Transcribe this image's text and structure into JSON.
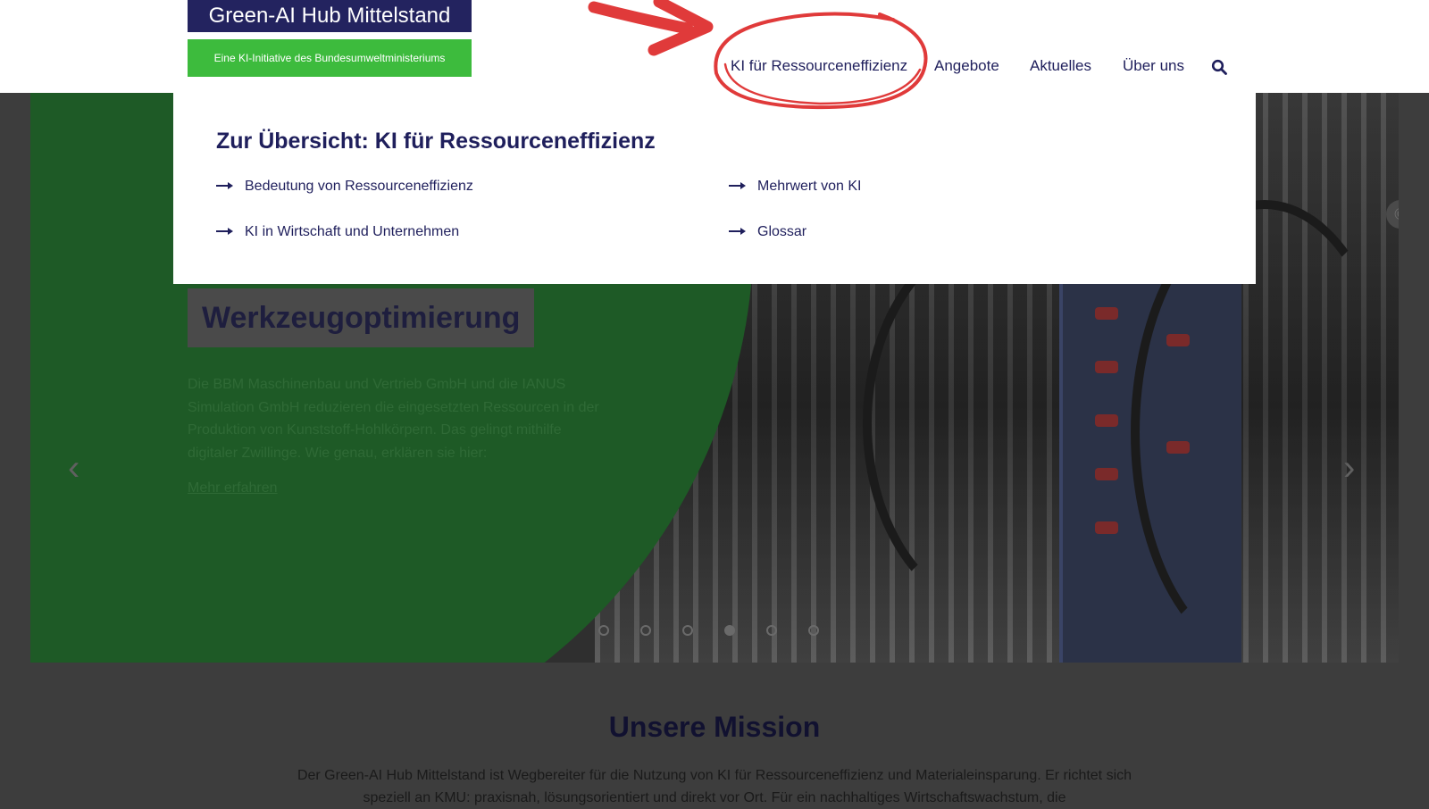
{
  "header": {
    "logo_title": "Green-AI Hub Mittelstand",
    "logo_subtitle": "Eine KI-Initiative des Bundesumweltministeriums",
    "nav": [
      {
        "label": "KI für Ressourceneffizienz"
      },
      {
        "label": "Angebote"
      },
      {
        "label": "Aktuelles"
      },
      {
        "label": "Über uns"
      }
    ],
    "search_icon": "search-icon"
  },
  "dropdown": {
    "title": "Zur Übersicht: KI für Ressourceneffizienz",
    "items": [
      {
        "label": "Bedeutung von Ressourceneffizienz"
      },
      {
        "label": "Mehrwert von KI"
      },
      {
        "label": "KI in Wirtschaft und Unternehmen"
      },
      {
        "label": "Glossar"
      }
    ],
    "arrow_icon": "arrow-right-icon"
  },
  "hero": {
    "slide_title": "Werkzeugoptimierung",
    "slide_text": "Die BBM Maschinenbau und Vertrieb GmbH und die IANUS Simulation GmbH reduzieren die eingesetzten Ressourcen in der Produktion von Kunststoff-Hohlkörpern. Das gelingt mithilfe digitaler Zwillinge. Wie genau, erklären sie hier:",
    "link_label": "Mehr erfahren",
    "copyright_symbol": "©",
    "prev_symbol": "‹",
    "next_symbol": "›",
    "slide_count": 6,
    "active_slide": 4
  },
  "mission": {
    "title": "Unsere Mission",
    "text": "Der Green-AI Hub Mittelstand ist Wegbereiter für die Nutzung von KI für Ressourceneffizienz und Materialeinsparung. Er richtet sich speziell an KMU: praxisnah, lösungsorientiert und direkt vor Ort. Für ein nachhaltiges Wirtschaftswachstum, die"
  },
  "colors": {
    "brand_navy": "#23235f",
    "brand_green": "#3dbb3d",
    "annotation_red": "#e03a3a",
    "overlay": "#3d3d3d"
  }
}
